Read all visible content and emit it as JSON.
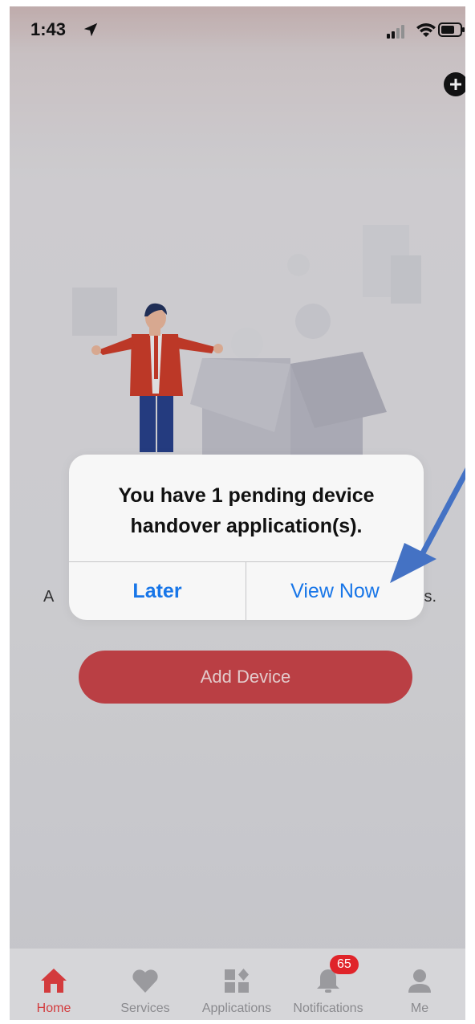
{
  "status_bar": {
    "time": "1:43"
  },
  "main": {
    "caption_left": "A",
    "caption_right": "s.",
    "add_device_label": "Add Device"
  },
  "alert": {
    "message_line1": "You have 1 pending device",
    "message_line2": "handover application(s).",
    "later_label": "Later",
    "view_now_label": "View Now"
  },
  "tabbar": {
    "items": [
      {
        "label": "Home",
        "icon": "home-icon",
        "active": true
      },
      {
        "label": "Services",
        "icon": "heart-icon"
      },
      {
        "label": "Applications",
        "icon": "apps-icon"
      },
      {
        "label": "Notifications",
        "icon": "bell-icon",
        "badge": "65"
      },
      {
        "label": "Me",
        "icon": "person-icon"
      }
    ]
  },
  "colors": {
    "accent": "#d33b3d",
    "button": "#c74246",
    "link": "#1876e8",
    "annotation": "#4472c4"
  }
}
